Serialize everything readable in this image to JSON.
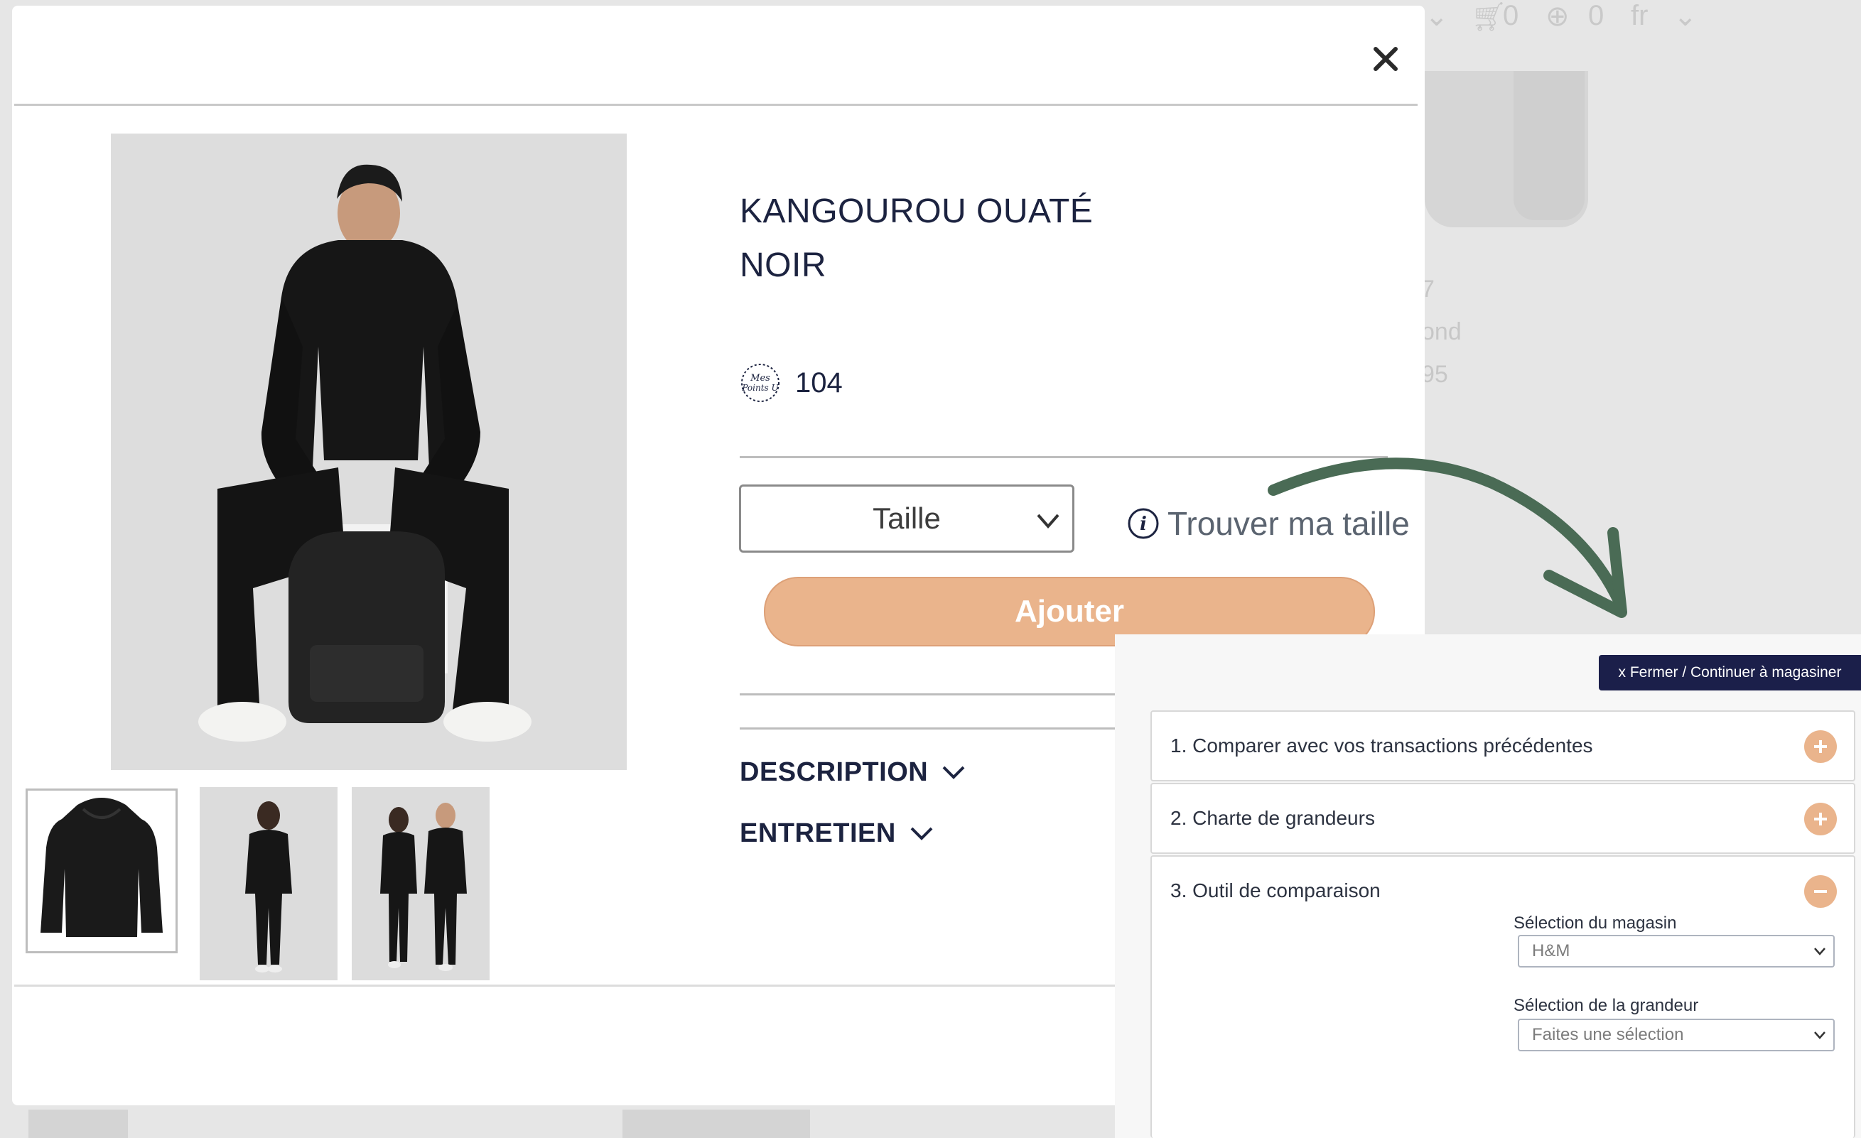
{
  "background": {
    "cart_count": "0",
    "points_count": "0",
    "language": "fr",
    "text_lines": [
      "7",
      "ond",
      "95"
    ]
  },
  "modal": {
    "close_icon": "close-icon",
    "product": {
      "title_line1": "KANGOUROU OUATÉ",
      "title_line2": "NOIR",
      "points_icon": "mes-points-u-badge-icon",
      "points": "104"
    },
    "size_select": {
      "value": "Taille",
      "icon": "chevron-down-icon"
    },
    "find_size": {
      "icon": "info-icon",
      "label": "Trouver ma taille"
    },
    "add_button": "Ajouter",
    "accordions": [
      {
        "label": "DESCRIPTION",
        "icon": "chevron-down-icon"
      },
      {
        "label": "ENTRETIEN",
        "icon": "chevron-down-icon"
      }
    ],
    "thumbnails": [
      "hoodie-front",
      "model-woman",
      "couple"
    ]
  },
  "panel": {
    "close_label": "x Fermer / Continuer à magasiner",
    "sections": [
      {
        "label": "1. Comparer avec vos transactions précédentes",
        "state": "collapsed"
      },
      {
        "label": "2. Charte de grandeurs",
        "state": "collapsed"
      },
      {
        "label": "3. Outil de comparaison",
        "state": "expanded"
      }
    ],
    "store_select": {
      "label": "Sélection du magasin",
      "value": "H&M"
    },
    "size_select": {
      "label": "Sélection de la grandeur",
      "value": "Faites une sélection"
    }
  },
  "colors": {
    "accent": "#eab48c",
    "navy": "#1c2340",
    "panel_button": "#1b1f4a",
    "arrow": "#4a6b55"
  }
}
